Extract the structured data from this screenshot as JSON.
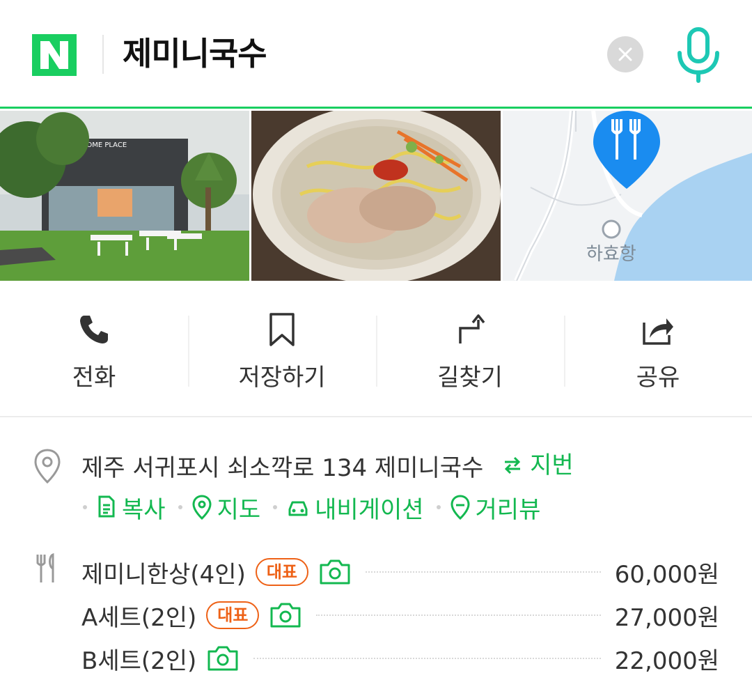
{
  "search": {
    "logo_letter": "N",
    "query": "제미니국수",
    "clear_icon": "close-icon",
    "mic_icon": "mic-icon"
  },
  "images": {
    "storefront_sign": "SOME PLACE",
    "map_label": "하효항"
  },
  "actions": [
    {
      "label": "전화",
      "icon": "phone-icon"
    },
    {
      "label": "저장하기",
      "icon": "bookmark-icon"
    },
    {
      "label": "길찾기",
      "icon": "directions-icon"
    },
    {
      "label": "공유",
      "icon": "share-icon"
    }
  ],
  "address": {
    "text": "제주 서귀포시 쇠소깍로 134 제미니국수",
    "jibun_label": "지번",
    "links": [
      {
        "label": "복사",
        "icon": "copy-icon"
      },
      {
        "label": "지도",
        "icon": "map-pin-icon"
      },
      {
        "label": "내비게이션",
        "icon": "car-icon"
      },
      {
        "label": "거리뷰",
        "icon": "street-view-icon"
      }
    ]
  },
  "menu": {
    "items": [
      {
        "name": "제미니한상(4인)",
        "badge": "대표",
        "price": "60,000원"
      },
      {
        "name": "A세트(2인)",
        "badge": "대표",
        "price": "27,000원"
      },
      {
        "name": "B세트(2인)",
        "badge": "",
        "price": "22,000원"
      }
    ]
  },
  "colors": {
    "brand_green": "#19ce60",
    "link_green": "#13b850",
    "mic_teal": "#1dc8b4",
    "badge_orange": "#ee6116",
    "map_pin_blue": "#1a8cf0"
  }
}
